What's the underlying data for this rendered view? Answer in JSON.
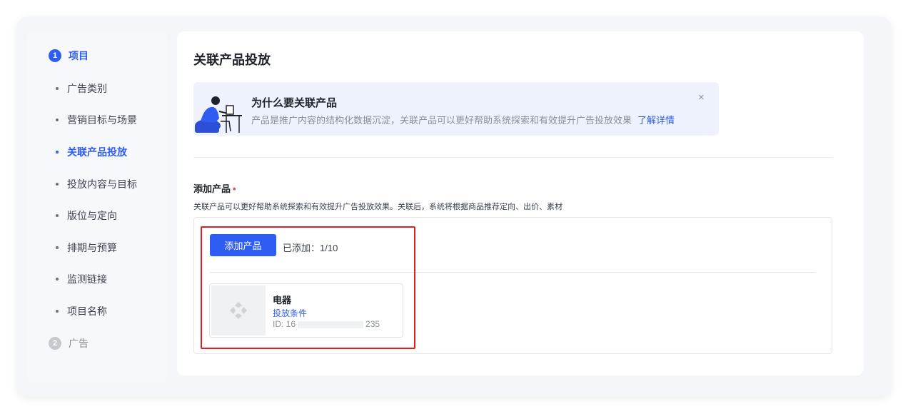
{
  "steps": [
    {
      "number": "1",
      "label": "项目"
    },
    {
      "number": "2",
      "label": "广告"
    }
  ],
  "sub_items": [
    {
      "label": "广告类别"
    },
    {
      "label": "营销目标与场景"
    },
    {
      "label": "关联产品投放"
    },
    {
      "label": "投放内容与目标"
    },
    {
      "label": "版位与定向"
    },
    {
      "label": "排期与预算"
    },
    {
      "label": "监测链接"
    },
    {
      "label": "项目名称"
    }
  ],
  "page_title": "关联产品投放",
  "banner": {
    "title": "为什么要关联产品",
    "description": "产品是推广内容的结构化数据沉淀，关联产品可以更好帮助系统探索和有效提升广告投放效果",
    "link": "了解详情",
    "close_icon": "×"
  },
  "add_product": {
    "title": "添加产品",
    "required_mark": "•",
    "description": "关联产品可以更好帮助系统探索和有效提升广告投放效果。关联后，系统将根据商品推荐定向、出价、素材",
    "button_label": "添加产品",
    "added_count": "已添加：1/10"
  },
  "product_card": {
    "name": "电器",
    "condition_link": "投放条件",
    "id_prefix": "ID: 16",
    "id_suffix": "235"
  },
  "colors": {
    "accent": "#2f5cf2",
    "highlight": "#e02020"
  }
}
